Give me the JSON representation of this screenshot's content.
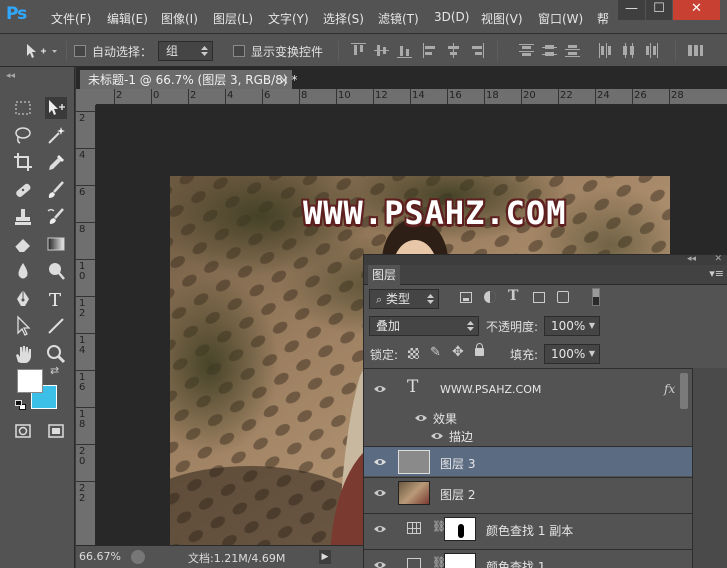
{
  "app": {
    "logo": "Ps"
  },
  "menu": [
    "文件(F)",
    "编辑(E)",
    "图像(I)",
    "图层(L)",
    "文字(Y)",
    "选择(S)",
    "滤镜(T)",
    "3D(D)",
    "视图(V)",
    "窗口(W)",
    "帮"
  ],
  "window_controls": {
    "minimize": "—",
    "maximize": "☐",
    "close": "✕"
  },
  "options": {
    "auto_select_label": "自动选择：",
    "auto_select_value": "组",
    "show_transform_label": "显示变换控件"
  },
  "document": {
    "tab_title": "未标题-1 @ 66.7% (图层 3, RGB/8) *",
    "tab_close": "×",
    "ruler_h_labels": [
      "2",
      "0",
      "2",
      "4",
      "6",
      "8",
      "10",
      "12",
      "14",
      "16",
      "18",
      "20",
      "22",
      "24",
      "26",
      "28"
    ],
    "ruler_v_labels": [
      "2",
      "4",
      "6",
      "8",
      "10",
      "12",
      "14",
      "16",
      "18",
      "20",
      "22"
    ],
    "watermark": "WWW.PSAHZ.COM"
  },
  "status": {
    "zoom": "66.67%",
    "doc_info": "文档:1.21M/4.69M"
  },
  "tools": [
    "marquee-tool",
    "move-tool",
    "lasso-tool",
    "magic-wand-tool",
    "crop-tool",
    "eyedropper-tool",
    "healing-brush-tool",
    "brush-tool",
    "clone-stamp-tool",
    "history-brush-tool",
    "eraser-tool",
    "gradient-tool",
    "blur-tool",
    "dodge-tool",
    "pen-tool",
    "type-tool",
    "path-selection-tool",
    "line-tool",
    "hand-tool",
    "zoom-tool"
  ],
  "colors": {
    "foreground": "#ffffff",
    "background": "#3cc0e8",
    "selected_layer": "#5b6b82",
    "logo": "#31a8ff"
  },
  "layers_panel": {
    "tab": "图层",
    "filter_kind": "类型",
    "blend_mode": "叠加",
    "opacity_label": "不透明度:",
    "opacity_value": "100%",
    "lock_label": "锁定:",
    "fill_label": "填充:",
    "fill_value": "100%",
    "layers": [
      {
        "name": "WWW.PSAHZ.COM",
        "kind": "text",
        "fx": "fx"
      },
      {
        "name": "效果",
        "kind": "effects"
      },
      {
        "name": "描边",
        "kind": "effect"
      },
      {
        "name": "图层 3",
        "kind": "pixel",
        "selected": true
      },
      {
        "name": "图层 2",
        "kind": "photo"
      },
      {
        "name": "颜色查找 1 副本",
        "kind": "adjustment"
      },
      {
        "name": "颜色查找 1",
        "kind": "adjustment"
      }
    ]
  }
}
